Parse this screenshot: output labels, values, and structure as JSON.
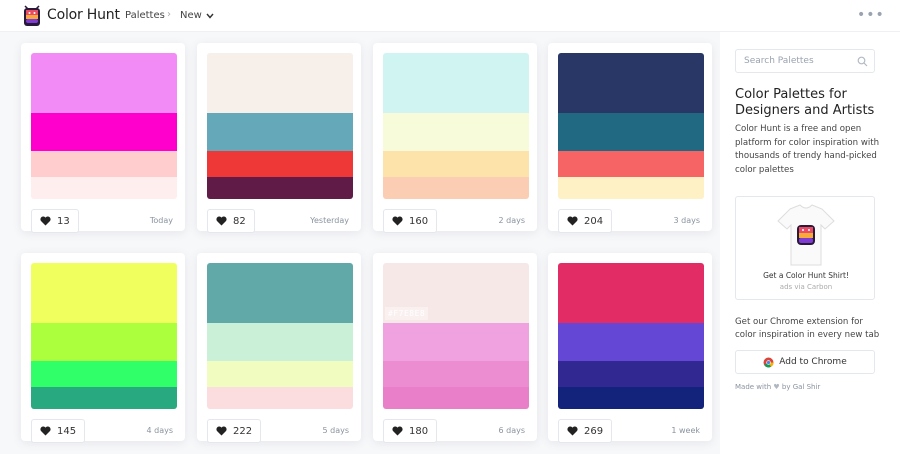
{
  "header": {
    "brand": "Color Hunt",
    "nav_palettes": "Palettes",
    "nav_separator": "›",
    "nav_new": "New",
    "more_label": "•••"
  },
  "palettes": [
    {
      "colors": [
        "#F38BF7",
        "#FF00CC",
        "#FFCDCD",
        "#FFEEEE"
      ],
      "likes": "13",
      "date": "Today"
    },
    {
      "colors": [
        "#F7EFE9",
        "#64A8BA",
        "#EE3838",
        "#611B47"
      ],
      "likes": "82",
      "date": "Yesterday"
    },
    {
      "colors": [
        "#D0F4F1",
        "#F7FBDA",
        "#FDE3A9",
        "#FBCDB2"
      ],
      "likes": "160",
      "date": "2 days"
    },
    {
      "colors": [
        "#283765",
        "#216883",
        "#F76466",
        "#FEF1C5"
      ],
      "likes": "204",
      "date": "3 days"
    },
    {
      "colors": [
        "#F1FF5E",
        "#ABFF3C",
        "#30FF6A",
        "#29A97F"
      ],
      "likes": "145",
      "date": "4 days"
    },
    {
      "colors": [
        "#61A9A8",
        "#CAF1D8",
        "#F1FCC1",
        "#FBDDE0"
      ],
      "likes": "222",
      "date": "5 days"
    },
    {
      "colors": [
        "#F7E8E8",
        "#F0A1E0",
        "#EC8DD1",
        "#E97EC9"
      ],
      "likes": "180",
      "date": "6 days",
      "hex_label": "#F7E8E8"
    },
    {
      "colors": [
        "#E22C66",
        "#6547D6",
        "#322892",
        "#13227A"
      ],
      "likes": "269",
      "date": "1 week"
    }
  ],
  "sidebar": {
    "search_placeholder": "Search Palettes",
    "title": "Color Palettes for Designers and Artists",
    "description": "Color Hunt is a free and open platform for color inspiration with thousands of trendy hand-picked color palettes",
    "ad_text": "Get a Color Hunt Shirt!",
    "ad_via": "ads via Carbon",
    "extension_text": "Get our Chrome extension for color inspiration in every new tab",
    "chrome_button": "Add to Chrome",
    "made_by_prefix": "Made with",
    "made_by_suffix": "by Gal Shir"
  },
  "colors": {
    "accent_logo": [
      "#E94B65",
      "#F7A93A",
      "#F6D746",
      "#7E3CD3"
    ],
    "heart": "#222222"
  }
}
